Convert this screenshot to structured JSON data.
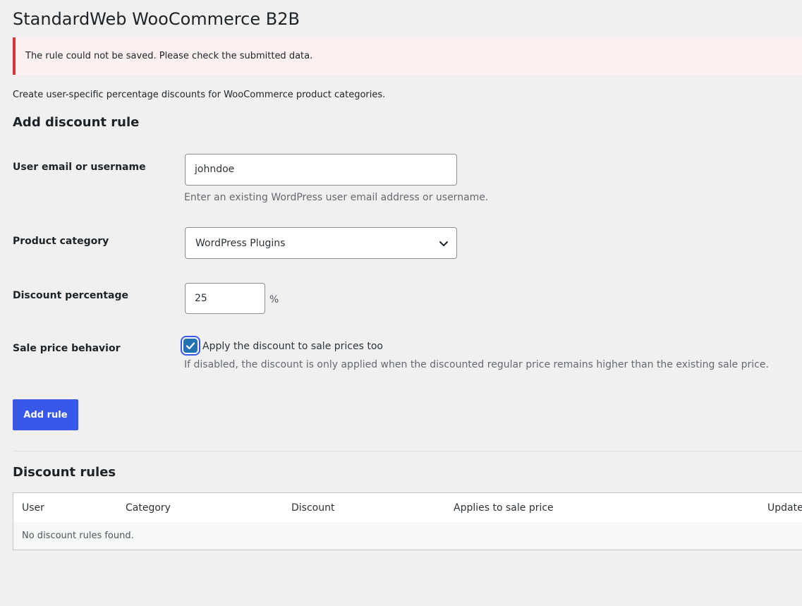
{
  "page": {
    "title": "StandardWeb WooCommerce B2B",
    "notice": "The rule could not be saved. Please check the submitted data.",
    "intro": "Create user-specific percentage discounts for WooCommerce product categories."
  },
  "form": {
    "heading": "Add discount rule",
    "user": {
      "label": "User email or username",
      "value": "johndoe",
      "description": "Enter an existing WordPress user email address or username."
    },
    "category": {
      "label": "Product category",
      "selected": "WordPress Plugins"
    },
    "discount": {
      "label": "Discount percentage",
      "value": "25",
      "unit": "%"
    },
    "sale": {
      "label": "Sale price behavior",
      "checkbox_label": "Apply the discount to sale prices too",
      "checked": true,
      "description": "If disabled, the discount is only applied when the discounted regular price remains higher than the existing sale price."
    },
    "submit_label": "Add rule"
  },
  "rules": {
    "heading": "Discount rules",
    "columns": [
      "User",
      "Category",
      "Discount",
      "Applies to sale price",
      "Updated"
    ],
    "empty_message": "No discount rules found."
  },
  "colors": {
    "primary_button": "#3858e9",
    "notice_border": "#d63638",
    "notice_bg": "#fcf0f1",
    "page_bg": "#f0f0f1"
  }
}
